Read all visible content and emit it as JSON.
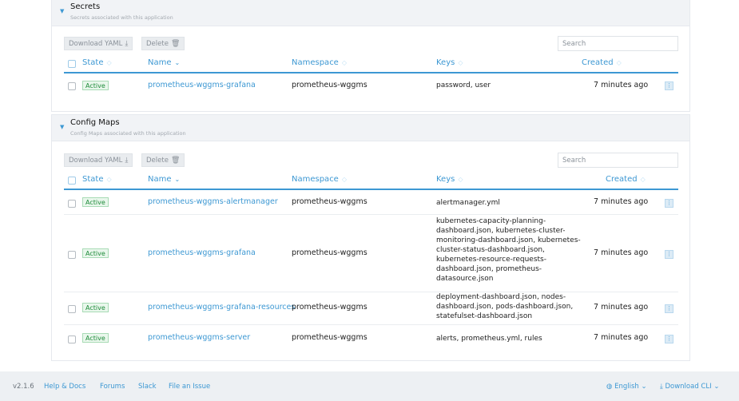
{
  "secrets": {
    "title": "Secrets",
    "subtitle": "Secrets associated with this application",
    "download_label": "Download YAML",
    "delete_label": "Delete",
    "search_placeholder": "Search",
    "headers": {
      "state": "State",
      "name": "Name",
      "namespace": "Namespace",
      "keys": "Keys",
      "created": "Created"
    },
    "rows": [
      {
        "state": "Active",
        "name": "prometheus-wggms-grafana",
        "namespace": "prometheus-wggms",
        "keys": "password, user",
        "created": "7 minutes ago"
      }
    ]
  },
  "configmaps": {
    "title": "Config Maps",
    "subtitle": "Config Maps associated with this application",
    "download_label": "Download YAML",
    "delete_label": "Delete",
    "search_placeholder": "Search",
    "headers": {
      "state": "State",
      "name": "Name",
      "namespace": "Namespace",
      "keys": "Keys",
      "created": "Created"
    },
    "rows": [
      {
        "state": "Active",
        "name": "prometheus-wggms-alertmanager",
        "namespace": "prometheus-wggms",
        "keys": "alertmanager.yml",
        "created": "7 minutes ago"
      },
      {
        "state": "Active",
        "name": "prometheus-wggms-grafana",
        "namespace": "prometheus-wggms",
        "keys": "kubernetes-capacity-planning-dashboard.json, kubernetes-cluster-monitoring-dashboard.json, kubernetes-cluster-status-dashboard.json, kubernetes-resource-requests-dashboard.json, prometheus-datasource.json",
        "created": "7 minutes ago"
      },
      {
        "state": "Active",
        "name": "prometheus-wggms-grafana-resources",
        "namespace": "prometheus-wggms",
        "keys": "deployment-dashboard.json, nodes-dashboard.json, pods-dashboard.json, statefulset-dashboard.json",
        "created": "7 minutes ago"
      },
      {
        "state": "Active",
        "name": "prometheus-wggms-server",
        "namespace": "prometheus-wggms",
        "keys": "alerts, prometheus.yml, rules",
        "created": "7 minutes ago"
      }
    ]
  },
  "footer": {
    "version": "v2.1.6",
    "help": "Help & Docs",
    "forums": "Forums",
    "slack": "Slack",
    "issue": "File an Issue",
    "language": "English",
    "download_cli": "Download CLI"
  },
  "icons": {
    "expand": "caret-down-icon",
    "download": "download-icon",
    "delete": "trash-icon",
    "sort": "sort-icon",
    "actions": "kebab-menu-icon",
    "language": "globe-icon"
  },
  "colors": {
    "accent": "#3d98d3",
    "active_badge": "#1e8b3a"
  }
}
